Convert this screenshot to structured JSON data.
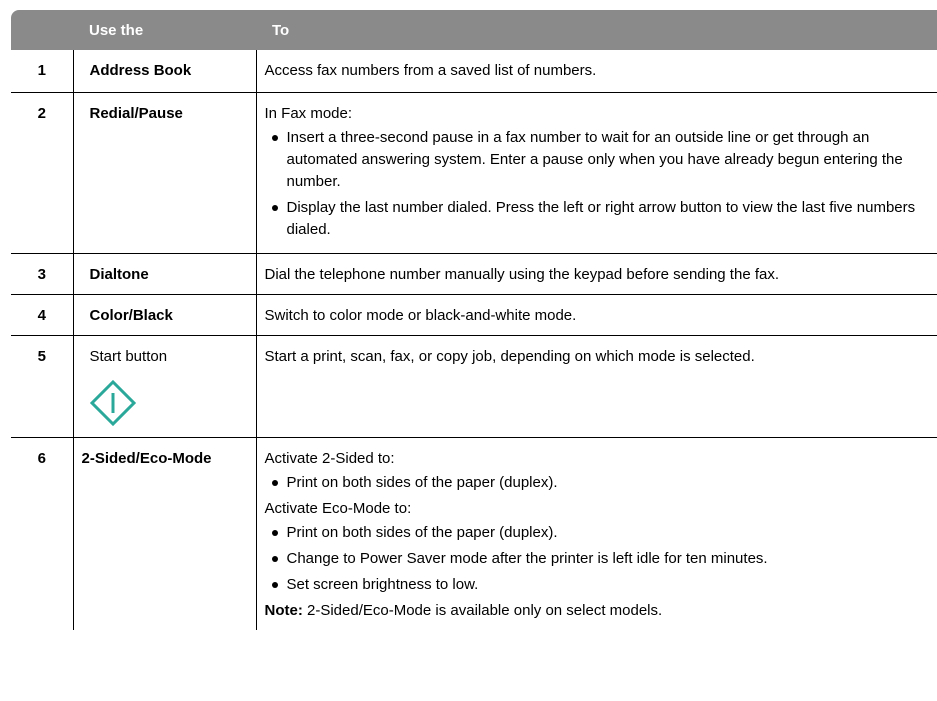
{
  "header": {
    "col_num": "",
    "col_use": "Use the",
    "col_to": "To"
  },
  "rows": [
    {
      "num": "1",
      "use": "Address Book",
      "to_text": "Access fax numbers from a saved list of numbers."
    },
    {
      "num": "2",
      "use": "Redial/Pause",
      "to_intro": "In Fax mode:",
      "bullets": [
        "Insert a three-second pause in a fax number to wait for an outside line or get through an automated answering system. Enter a pause only when you have already begun entering the number.",
        "Display the last number dialed. Press the left or right arrow button to view the last five numbers dialed."
      ]
    },
    {
      "num": "3",
      "use": "Dialtone",
      "to_text": "Dial the telephone number manually using the keypad before sending the fax."
    },
    {
      "num": "4",
      "use": "Color/Black",
      "to_text": "Switch to color mode or black-and-white mode."
    },
    {
      "num": "5",
      "use": "Start button",
      "icon": "start-diamond-icon",
      "icon_color": "#2aa89a",
      "to_text": "Start a print, scan, fax, or copy job, depending on which mode is selected."
    },
    {
      "num": "6",
      "use": "2-Sided/Eco-Mode",
      "to_intro": "Activate 2-Sided to:",
      "bullets_a": [
        "Print on both sides of the paper (duplex)."
      ],
      "to_intro_b": "Activate Eco-Mode to:",
      "bullets_b": [
        "Print on both sides of the paper (duplex).",
        "Change to Power Saver mode after the printer is left idle for ten minutes.",
        "Set screen brightness to low."
      ],
      "note_label": "Note:",
      "note_text": " 2-Sided/Eco-Mode is available only on select models."
    }
  ],
  "colors": {
    "header_bg": "#8a8a8a",
    "header_text": "#ffffff",
    "border": "#000000",
    "start_icon": "#2aa89a"
  }
}
